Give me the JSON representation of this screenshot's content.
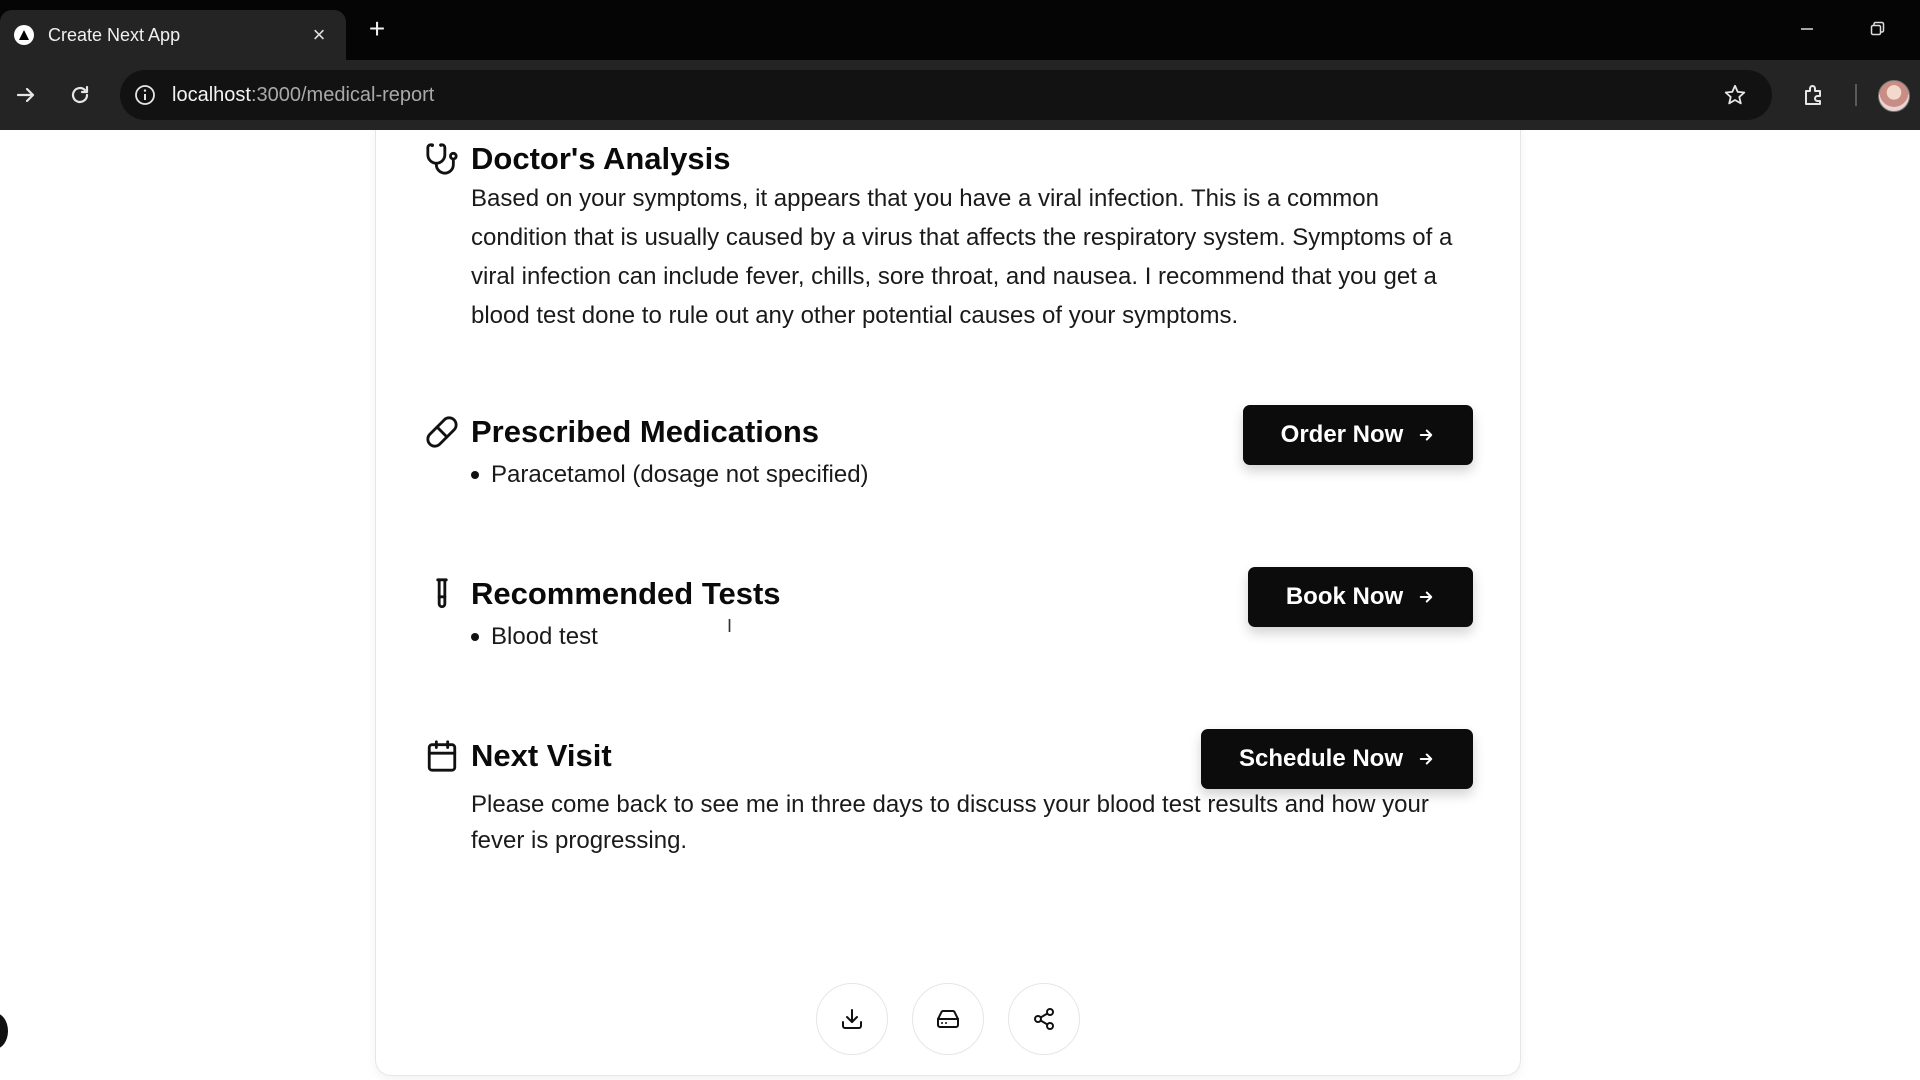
{
  "browser": {
    "tab": {
      "title": "Create Next App",
      "favicon": "next-triangle-icon",
      "close_glyph": "×"
    },
    "new_tab_glyph": "+",
    "address": {
      "host": "localhost",
      "path": ":3000/medical-report"
    }
  },
  "report": {
    "analysis": {
      "title": "Doctor's Analysis",
      "icon": "stethoscope-icon",
      "lines": [
        "Based on your symptoms, it appears that you have a viral infection. This is a common",
        "condition that is usually caused by a virus that affects the respiratory system. Symptoms of a",
        "viral infection can include fever, chills, sore throat, and nausea. I recommend that you get a",
        "blood test done to rule out any other potential causes of your symptoms."
      ]
    },
    "medications": {
      "title": "Prescribed Medications",
      "icon": "pill-icon",
      "items": [
        "Paracetamol (dosage not specified)"
      ],
      "cta": "Order Now"
    },
    "tests": {
      "title": "Recommended Tests",
      "icon": "test-tube-icon",
      "items": [
        "Blood test"
      ],
      "cta": "Book Now"
    },
    "next_visit": {
      "title": "Next Visit",
      "icon": "calendar-icon",
      "lines": [
        "Please come back to see me in three days to discuss your blood test results and how your",
        "fever is progressing."
      ],
      "cta": "Schedule Now"
    }
  },
  "actions": [
    {
      "icon": "download-icon"
    },
    {
      "icon": "printer-icon"
    },
    {
      "icon": "share-icon"
    }
  ],
  "colors": {
    "button_bg": "#0c0c0c",
    "chrome_bg": "#242424",
    "tabbar_bg": "#050505"
  }
}
